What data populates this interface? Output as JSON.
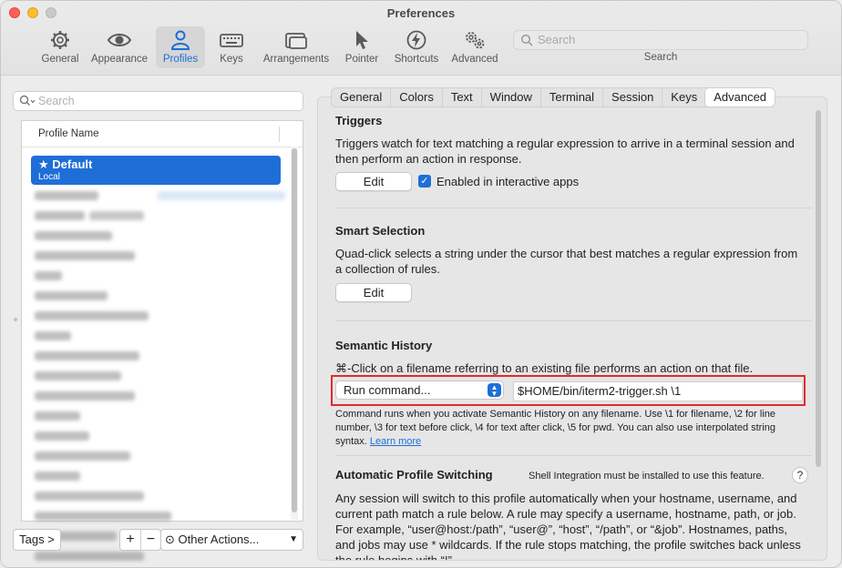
{
  "window": {
    "title": "Preferences"
  },
  "toolbar": {
    "items": [
      {
        "label": "General",
        "icon": "gear-icon"
      },
      {
        "label": "Appearance",
        "icon": "eye-icon"
      },
      {
        "label": "Profiles",
        "icon": "person-icon"
      },
      {
        "label": "Keys",
        "icon": "keyboard-icon"
      },
      {
        "label": "Arrangements",
        "icon": "windows-icon"
      },
      {
        "label": "Pointer",
        "icon": "cursor-icon"
      },
      {
        "label": "Shortcuts",
        "icon": "bolt-icon"
      },
      {
        "label": "Advanced",
        "icon": "gears-icon"
      }
    ],
    "active": "Profiles",
    "search_placeholder": "Search",
    "search_caption": "Search"
  },
  "profiles": {
    "search_placeholder": "Search",
    "column_header": "Profile Name",
    "selected": {
      "name": "Default",
      "subtitle": "Local"
    }
  },
  "bottom": {
    "tags_label": "Tags >",
    "plus": "+",
    "minus": "−",
    "other_actions": "Other Actions..."
  },
  "tabs": [
    "General",
    "Colors",
    "Text",
    "Window",
    "Terminal",
    "Session",
    "Keys",
    "Advanced"
  ],
  "active_tab": "Advanced",
  "triggers": {
    "title": "Triggers",
    "description": "Triggers watch for text matching a regular expression to arrive in a terminal session and then perform an action in response.",
    "edit_label": "Edit",
    "checkbox_label": "Enabled in interactive apps",
    "checked": true
  },
  "smart_selection": {
    "title": "Smart Selection",
    "description": "Quad-click selects a string under the cursor that best matches a regular expression from a collection of rules.",
    "edit_label": "Edit"
  },
  "semantic_history": {
    "title": "Semantic History",
    "description": "⌘-Click on a filename referring to an existing file performs an action on that file.",
    "action_value": "Run command...",
    "command_value": "$HOME/bin/iterm2-trigger.sh \\1",
    "help_text": "Command runs when you activate Semantic History on any filename. Use \\1 for filename, \\2 for line number, \\3 for text before click, \\4 for text after click, \\5 for pwd. You can also use interpolated string syntax.",
    "learn_more": "Learn more"
  },
  "auto_switching": {
    "title": "Automatic Profile Switching",
    "note": "Shell Integration must be installed to use this feature.",
    "help": "?",
    "description": "Any session will switch to this profile automatically when your hostname, username, and current path match a rule below. A rule may specify a username, hostname, path, or job. For example, “user@host:/path”, “user@”, “host”, “/path”, or “&job”. Hostnames, paths, and jobs may use * wildcards. If the rule stops matching, the profile switches back unless the rule begins with “!”."
  },
  "colors": {
    "accent": "#1f6ed8",
    "highlight": "#e02b2b"
  }
}
